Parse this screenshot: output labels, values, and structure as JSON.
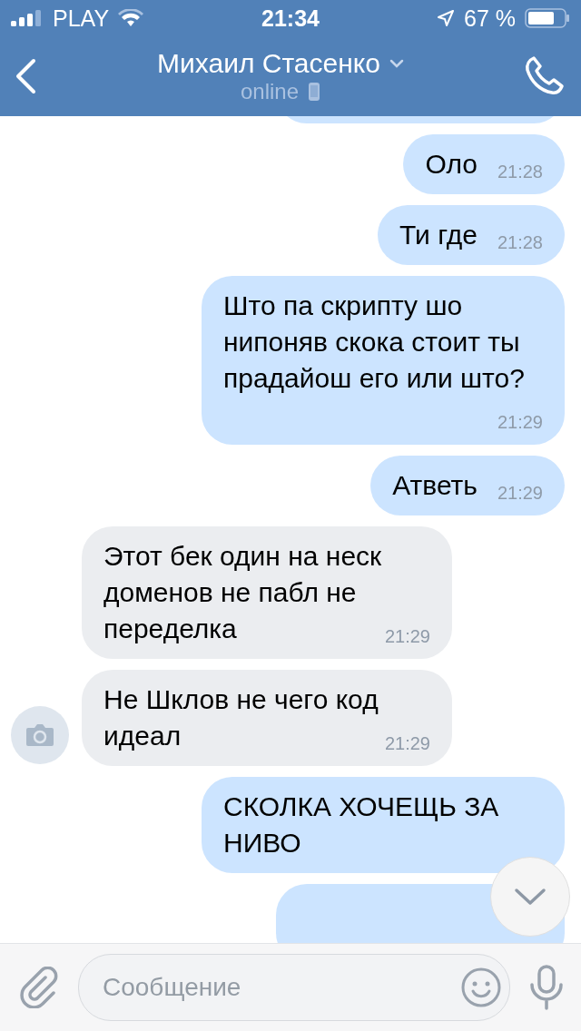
{
  "status_bar": {
    "carrier": "PLAY",
    "time": "21:34",
    "battery": "67 %"
  },
  "header": {
    "name": "Михаил Стасенко",
    "presence": "online"
  },
  "messages": [
    {
      "kind": "partial",
      "outgoing": true
    },
    {
      "kind": "text",
      "outgoing": true,
      "text": "Оло",
      "time": "21:28"
    },
    {
      "kind": "text",
      "outgoing": true,
      "text": "Ти где",
      "time": "21:28"
    },
    {
      "kind": "text",
      "outgoing": true,
      "text": "Што па скрипту шо нипоняв скока стоит ты прадайош его или што?",
      "time": "21:29"
    },
    {
      "kind": "text",
      "outgoing": true,
      "text": "Атветь",
      "time": "21:29"
    },
    {
      "kind": "text",
      "outgoing": false,
      "text": "Этот бек один на неск доменов не пабл не переделка",
      "time": "21:29",
      "avatar": false
    },
    {
      "kind": "text",
      "outgoing": false,
      "text": "Не Шклов не чего код идеал",
      "time": "21:29",
      "avatar": true
    },
    {
      "kind": "text",
      "outgoing": true,
      "text": "СКОЛКА ХОЧЕЩЬ ЗА НИВО"
    },
    {
      "kind": "partial",
      "outgoing": true
    }
  ],
  "composer": {
    "placeholder": "Сообщение"
  }
}
